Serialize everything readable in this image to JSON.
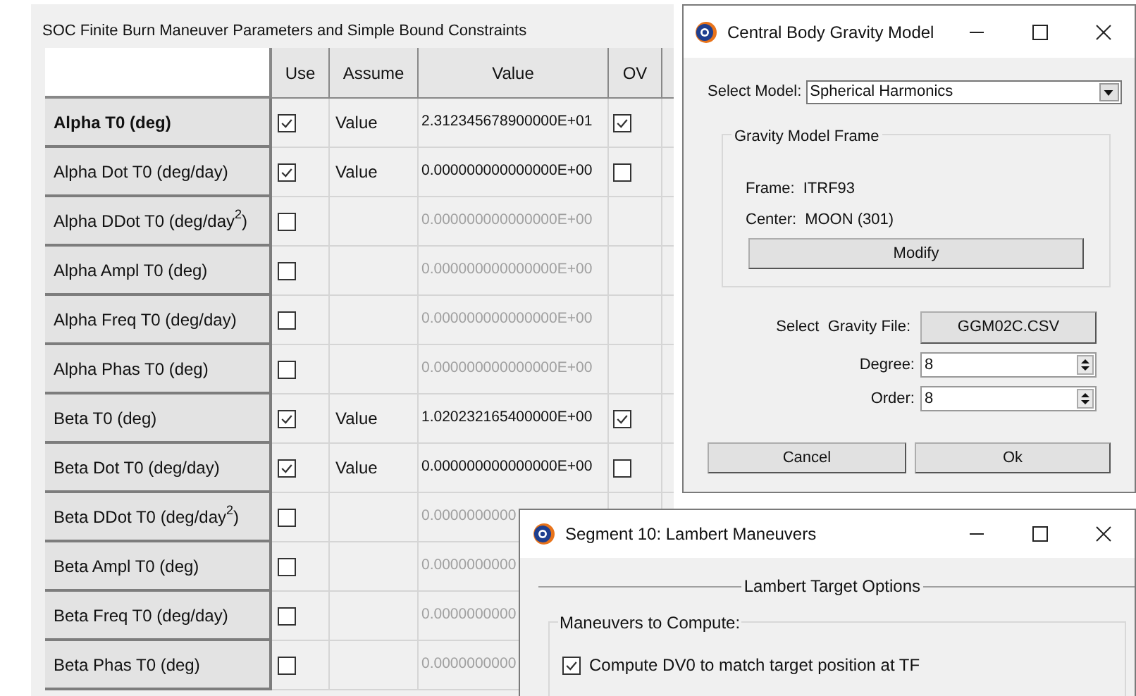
{
  "panel": {
    "title": "SOC Finite Burn Maneuver Parameters and Simple Bound Constraints"
  },
  "table": {
    "columns": [
      "Use",
      "Assume",
      "Value",
      "OV"
    ],
    "rows": [
      {
        "label": "Alpha T0 (deg)",
        "selected": true,
        "use": true,
        "assume": "Value",
        "value": "2.312345678900000E+01",
        "disabled": false,
        "ov": true
      },
      {
        "label": "Alpha Dot T0 (deg/day)",
        "selected": false,
        "use": true,
        "assume": "Value",
        "value": "0.000000000000000E+00",
        "disabled": false,
        "ov": false
      },
      {
        "label": "Alpha DDot T0 (deg/day$^{2}$)",
        "selected": false,
        "use": false,
        "value": "0.000000000000000E+00",
        "disabled": true
      },
      {
        "label": "Alpha Ampl T0 (deg)",
        "selected": false,
        "use": false,
        "value": "0.000000000000000E+00",
        "disabled": true
      },
      {
        "label": "Alpha Freq T0 (deg/day)",
        "selected": false,
        "use": false,
        "value": "0.000000000000000E+00",
        "disabled": true
      },
      {
        "label": "Alpha Phas T0 (deg)",
        "selected": false,
        "use": false,
        "value": "0.000000000000000E+00",
        "disabled": true
      },
      {
        "label": "Beta T0 (deg)",
        "selected": false,
        "use": true,
        "assume": "Value",
        "value": "1.020232165400000E+00",
        "disabled": false,
        "ov": true
      },
      {
        "label": "Beta Dot T0 (deg/day)",
        "selected": false,
        "use": true,
        "assume": "Value",
        "value": "0.000000000000000E+00",
        "disabled": false,
        "ov": false
      },
      {
        "label": "Beta DDot T0 (deg/day$^{2}$)",
        "selected": false,
        "use": false,
        "value": "0.0000000000",
        "disabled": true
      },
      {
        "label": "Beta Ampl T0 (deg)",
        "selected": false,
        "use": false,
        "value": "0.0000000000",
        "disabled": true
      },
      {
        "label": "Beta Freq T0 (deg/day)",
        "selected": false,
        "use": false,
        "value": "0.0000000000",
        "disabled": true
      },
      {
        "label": "Beta Phas T0 (deg)",
        "selected": false,
        "use": false,
        "value": "0.0000000000",
        "disabled": true
      }
    ]
  },
  "gravity_dialog": {
    "title": "Central Body Gravity Model",
    "select_model": {
      "label": "Select Model:",
      "value": "Spherical Harmonics"
    },
    "frame_group": {
      "title": "Gravity Model Frame",
      "frame_label": "Frame:",
      "frame": "ITRF93",
      "center_label": "Center:",
      "center": "MOON (301)",
      "button": "Modify"
    },
    "gravity_file": {
      "label": "Select  Gravity File:",
      "button": "GGM02C.CSV"
    },
    "degree": {
      "label": "Degree:",
      "value": "8"
    },
    "order": {
      "label": "Order:",
      "value": "8"
    },
    "buttons": [
      "Cancel",
      "Ok"
    ]
  },
  "lambert_dialog": {
    "title": "Segment 10: Lambert Maneuvers",
    "section": "Lambert Target Options",
    "group": "Maneuvers to Compute:",
    "options": [
      {
        "label": "Compute DV0 to match target position at TF",
        "checked": true
      }
    ]
  }
}
